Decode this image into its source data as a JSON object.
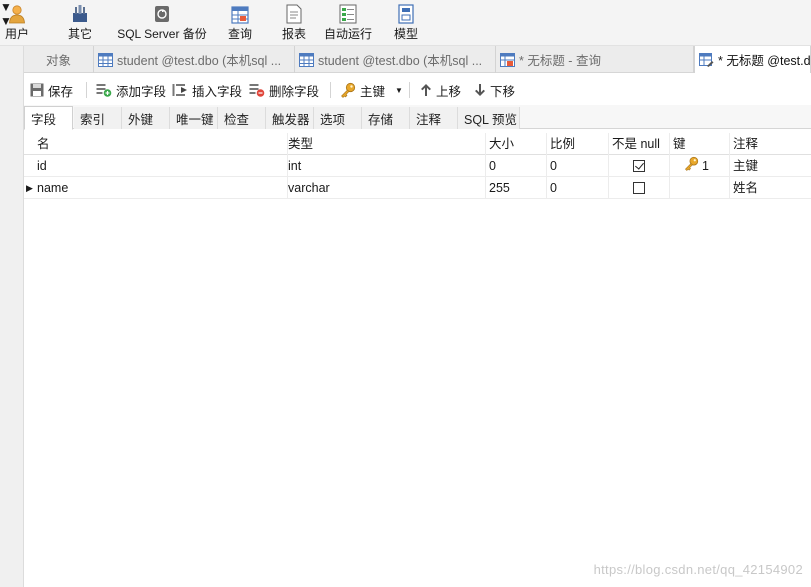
{
  "ribbon": {
    "user": "用户",
    "other": "其它",
    "backup": "SQL Server 备份",
    "query": "查询",
    "report": "报表",
    "automation": "自动运行",
    "model": "模型"
  },
  "doc_tabs": {
    "objects": "对象",
    "tab1": "student @test.dbo (本机sql ...",
    "tab2": "student @test.dbo (本机sql ...",
    "tab3": "* 无标题 - 查询",
    "tab4": "* 无标题 @test.d"
  },
  "actions": {
    "save": "保存",
    "add_field": "添加字段",
    "insert_field": "插入字段",
    "delete_field": "删除字段",
    "primary_key": "主键",
    "move_up": "上移",
    "move_down": "下移"
  },
  "sub_tabs": [
    "字段",
    "索引",
    "外键",
    "唯一键",
    "检查",
    "触发器",
    "选项",
    "存储",
    "注释",
    "SQL 预览"
  ],
  "grid": {
    "headers": {
      "name": "名",
      "type": "类型",
      "size": "大小",
      "scale": "比例",
      "not_null": "不是 null",
      "key": "键",
      "comment": "注释"
    },
    "rows": [
      {
        "name": "id",
        "type": "int",
        "size": "0",
        "scale": "0",
        "not_null": true,
        "key": "1",
        "comment": "主键"
      },
      {
        "name": "name",
        "type": "varchar",
        "size": "255",
        "scale": "0",
        "not_null": false,
        "key": "",
        "comment": "姓名"
      }
    ]
  },
  "watermark": "https://blog.csdn.net/qq_42154902"
}
